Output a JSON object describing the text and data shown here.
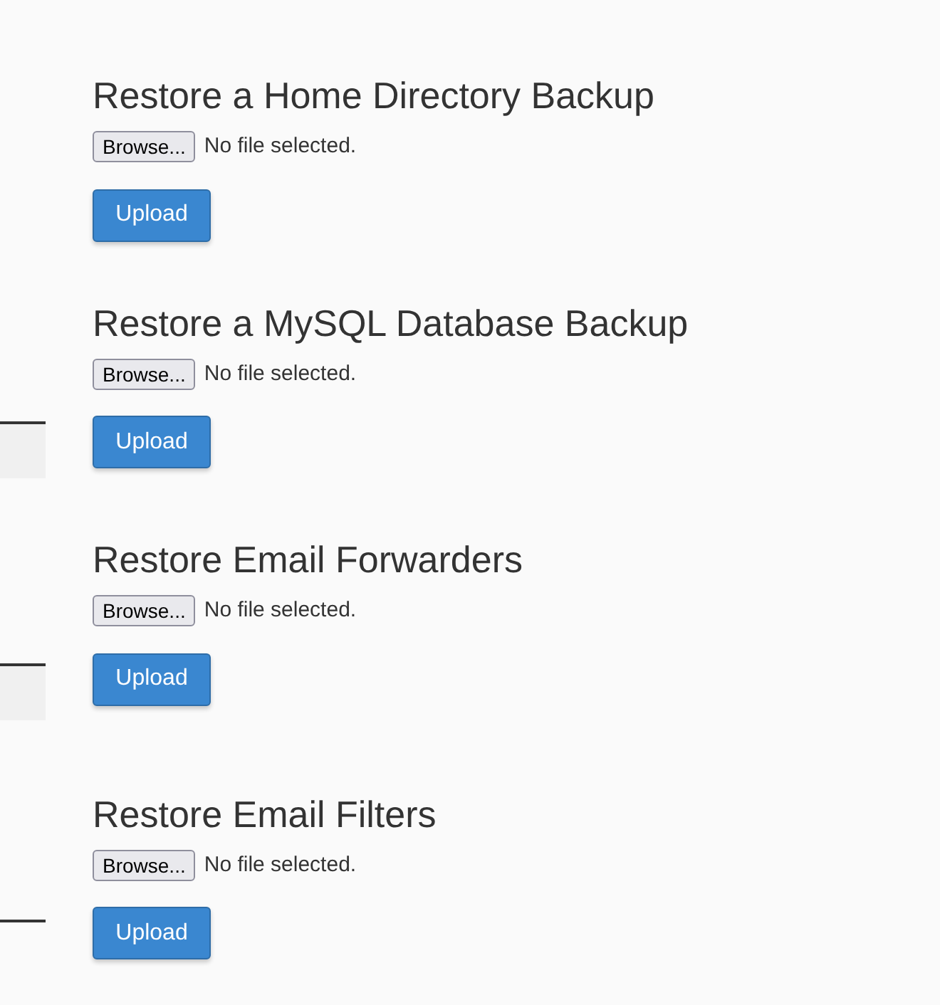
{
  "sections": [
    {
      "title": "Restore a Home Directory Backup",
      "browse_label": "Browse...",
      "file_status": "No file selected.",
      "upload_label": "Upload"
    },
    {
      "title": "Restore a MySQL Database Backup",
      "browse_label": "Browse...",
      "file_status": "No file selected.",
      "upload_label": "Upload"
    },
    {
      "title": "Restore Email Forwarders",
      "browse_label": "Browse...",
      "file_status": "No file selected.",
      "upload_label": "Upload"
    },
    {
      "title": "Restore Email Filters",
      "browse_label": "Browse...",
      "file_status": "No file selected.",
      "upload_label": "Upload"
    }
  ]
}
